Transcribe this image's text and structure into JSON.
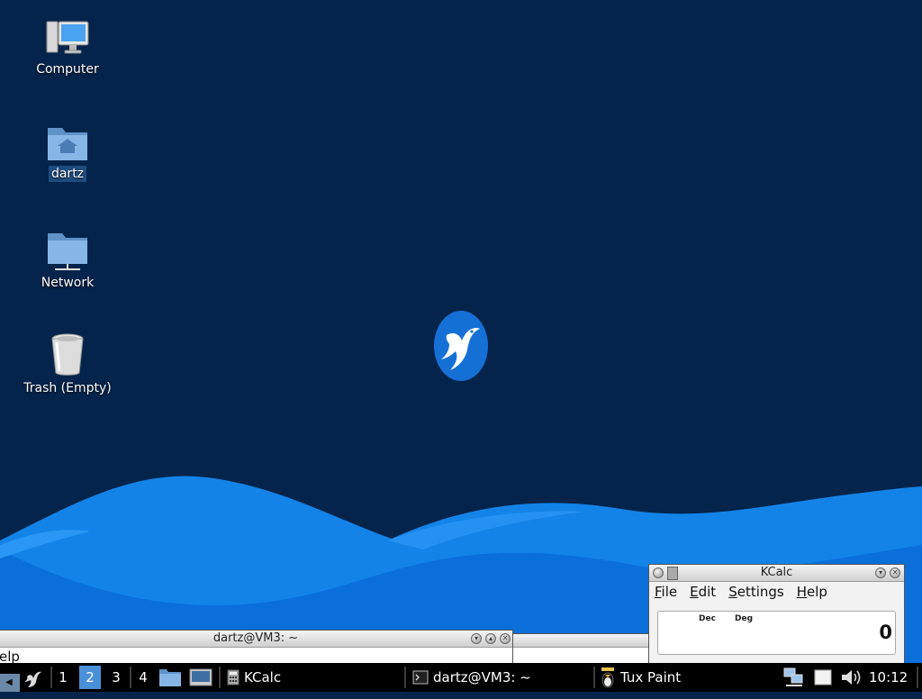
{
  "desktop": {
    "icons": [
      {
        "label": "Computer",
        "icon": "computer-icon"
      },
      {
        "label": "dartz",
        "icon": "home-folder-icon"
      },
      {
        "label": "Network",
        "icon": "network-folder-icon"
      },
      {
        "label": "Trash (Empty)",
        "icon": "trash-icon"
      }
    ],
    "wallpaper_colors": {
      "background": "#04244b",
      "wave_light": "#2a96f5",
      "wave_dark": "#0a6fd9",
      "logo": "#1570d6"
    }
  },
  "terminal_window": {
    "title": "dartz@VM3: ~",
    "menu_fragment": "elp"
  },
  "kcalc_window": {
    "title": "KCalc",
    "menu": [
      "File",
      "Edit",
      "Settings",
      "Help"
    ],
    "display": {
      "mode_base": "Dec",
      "mode_angle": "Deg",
      "value": "0"
    }
  },
  "taskbar": {
    "workspaces": [
      "1",
      "2",
      "3",
      "4"
    ],
    "active_workspace": "2",
    "tasks": [
      {
        "label": "KCalc",
        "icon": "calculator-icon"
      },
      {
        "label": "dartz@VM3: ~",
        "icon": "terminal-icon"
      },
      {
        "label": "Tux Paint",
        "icon": "tux-paint-icon"
      }
    ],
    "clock": "10:12"
  }
}
